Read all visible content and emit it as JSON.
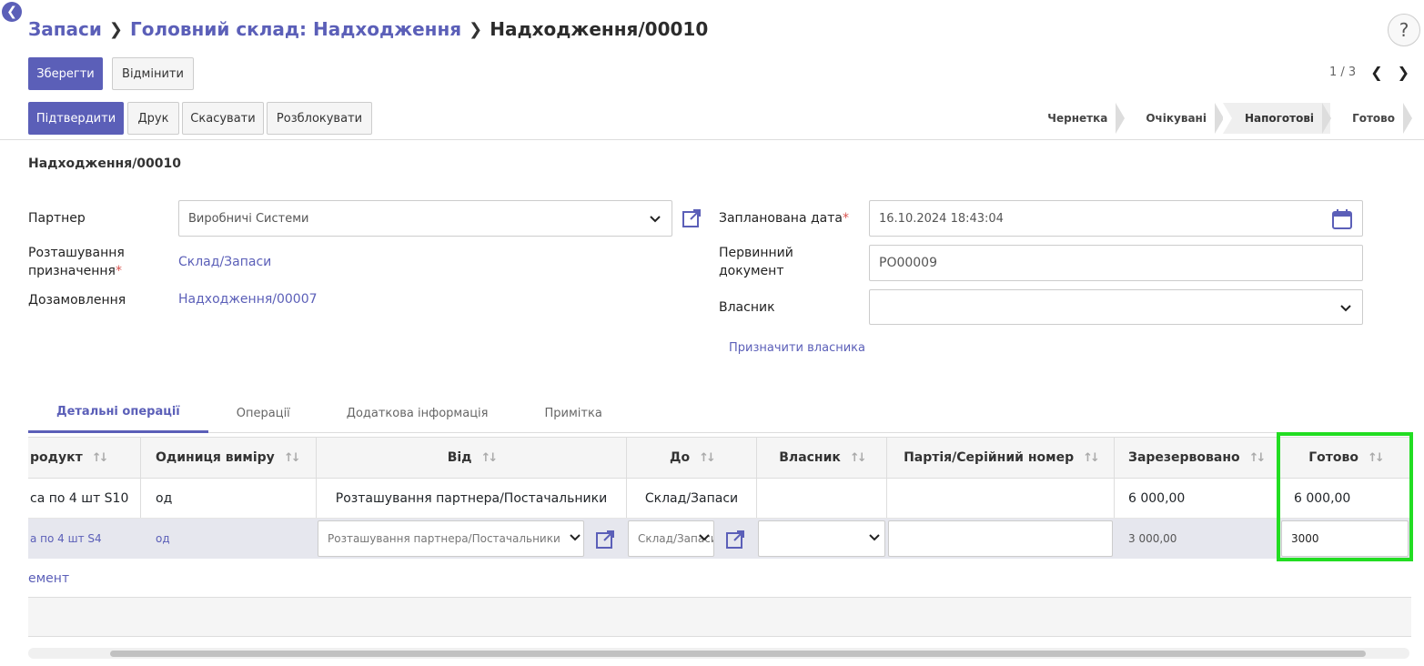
{
  "breadcrumb": {
    "level1": "Запаси",
    "level2": "Головний склад: Надходження",
    "current": "Надходження/00010"
  },
  "help_label": "?",
  "toolbar": {
    "save_label": "Зберегти",
    "discard_label": "Відмінити"
  },
  "pager": {
    "text": "1 / 3"
  },
  "actions": {
    "confirm_label": "Підтвердити",
    "print_label": "Друк",
    "cancel_label": "Скасувати",
    "unlock_label": "Розблокувати"
  },
  "stages": [
    {
      "label": "Чернетка"
    },
    {
      "label": "Очікувані"
    },
    {
      "label": "Напоготові"
    },
    {
      "label": "Готово"
    }
  ],
  "form": {
    "name": "Надходження/00010",
    "partner_label": "Партнер",
    "partner_value": "Виробничі Системи",
    "dest_label_1": "Розташування",
    "dest_label_2": "призначення",
    "dest_value": "Склад/Запаси",
    "backorder_label": "Дозамовлення",
    "backorder_value": "Надходження/00007",
    "scheduled_label": "Запланована дата",
    "scheduled_value": "16.10.2024 18:43:04",
    "origin_label_1": "Первинний",
    "origin_label_2": "документ",
    "origin_value": "PO00009",
    "owner_label": "Власник",
    "owner_value": "",
    "assign_owner": "Призначити власника"
  },
  "tabs": [
    {
      "label": "Детальні операції"
    },
    {
      "label": "Операції"
    },
    {
      "label": "Додаткова інформація"
    },
    {
      "label": "Примітка"
    }
  ],
  "table": {
    "headers": {
      "product": "родукт",
      "uom": "Одиниця виміру",
      "from": "Від",
      "to": "До",
      "owner": "Власник",
      "lot": "Партія/Серійний номер",
      "reserved": "Зарезервовано",
      "done": "Готово"
    },
    "row1": {
      "product": "са по 4 шт S10",
      "uom": "од",
      "from": "Розташування партнера/Постачальники",
      "to": "Склад/Запаси",
      "owner": "",
      "lot": "",
      "reserved": "6 000,00",
      "done": "6 000,00"
    },
    "row2": {
      "product": "а по 4 шт S4",
      "uom": "од",
      "from": "Розташування партнера/Постачальники",
      "to": "Склад/Запаси",
      "owner": "",
      "lot": "",
      "reserved": "3 000,00",
      "done": "3000"
    },
    "add_line": "емент"
  },
  "colors": {
    "accent": "#5b5fb8",
    "highlight": "#22dd22",
    "required": "#d9534f"
  }
}
